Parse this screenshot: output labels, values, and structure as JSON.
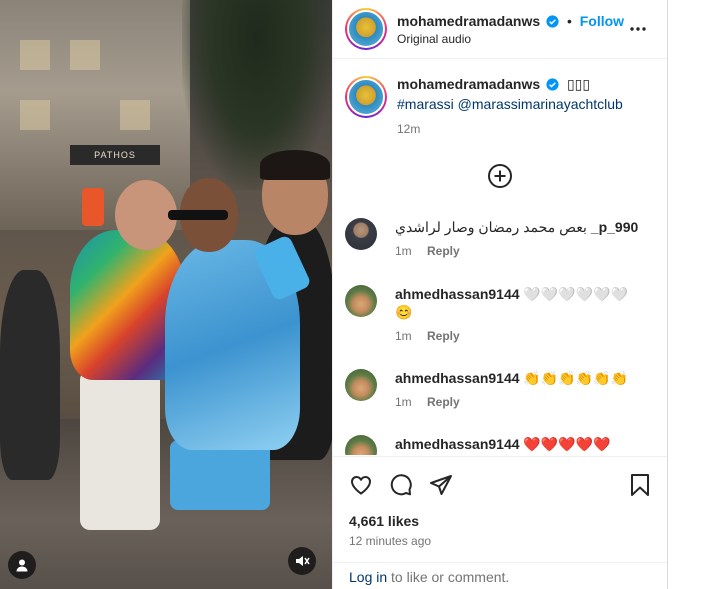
{
  "post": {
    "username": "mohamedramadanws",
    "follow_label": "Follow",
    "dot": "•",
    "audio": "Original audio",
    "caption_emoji": "▯▯▯",
    "caption_tags": "#marassi @marassimarinayachtclub",
    "caption_time": "12m",
    "likes": "4,661 likes",
    "posted": "12 minutes ago"
  },
  "video_overlay": {
    "store_sign": "PATHOS"
  },
  "comments": [
    {
      "user": "_p_990",
      "text": "بعص محمد رمضان وصار لراشدي",
      "time": "1m",
      "reply": "Reply"
    },
    {
      "user": "ahmedhassan9144",
      "text": "🤍🤍🤍🤍🤍🤍",
      "text2": "😊",
      "time": "1m",
      "reply": "Reply"
    },
    {
      "user": "ahmedhassan9144",
      "text": "👏👏👏👏👏👏",
      "time": "1m",
      "reply": "Reply"
    },
    {
      "user": "ahmedhassan9144",
      "text": "❤️❤️❤️❤️❤️"
    }
  ],
  "footer": {
    "login_link": "Log in",
    "login_rest": " to like or comment."
  },
  "icons": [
    "user-icon",
    "mute-icon",
    "verified-icon",
    "more-icon",
    "add-comment-icon",
    "heart-icon",
    "comment-icon",
    "share-icon",
    "bookmark-icon"
  ],
  "colors": {
    "link": "#0095f6",
    "tag": "#00376b",
    "muted": "#737373",
    "verified": "#0095f6"
  }
}
